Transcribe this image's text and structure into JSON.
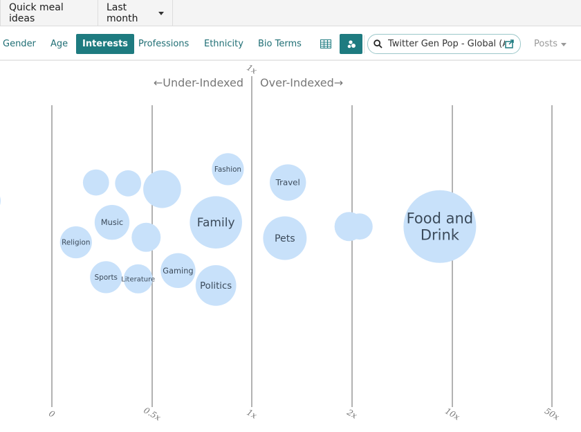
{
  "topbar": {
    "query_name": "Quick meal ideas",
    "date_range": "Last month"
  },
  "tabs": [
    {
      "label": "Gender",
      "active": false
    },
    {
      "label": "Age",
      "active": false
    },
    {
      "label": "Interests",
      "active": true
    },
    {
      "label": "Professions",
      "active": false
    },
    {
      "label": "Ethnicity",
      "active": false
    },
    {
      "label": "Bio Terms",
      "active": false
    }
  ],
  "view_toggle": {
    "table_icon": "table-grid-icon",
    "bubble_icon": "bubble-chart-icon",
    "active": "bubble"
  },
  "audience_search": {
    "value": "Twitter Gen Pop - Global (All)",
    "icon": "search-icon",
    "action_icon": "external-link-icon"
  },
  "metric_dropdown": {
    "label": "Posts"
  },
  "chart_data": {
    "type": "scatter",
    "subtype": "bubble",
    "title": "",
    "xlabel": "",
    "ylabel": "",
    "annotations": {
      "center_tick": "1x",
      "left": "←Under-Indexed",
      "right": "Over-Indexed→"
    },
    "x_scale": "index",
    "x_ticks": [
      "0",
      "0.5x",
      "1x",
      "2x",
      "10x",
      "50x"
    ],
    "grid": true,
    "legend": "none",
    "bubbles": [
      {
        "label": "",
        "index": 0.0,
        "size": 1.0,
        "y": 0.5,
        "partial": true
      },
      {
        "label": "",
        "index": 0.22,
        "size": 0.9,
        "y": 0.72
      },
      {
        "label": "",
        "index": 0.38,
        "size": 0.9,
        "y": 0.71
      },
      {
        "label": "",
        "index": 0.55,
        "size": 1.3,
        "y": 0.64
      },
      {
        "label": "Fashion",
        "index": 0.88,
        "size": 1.1,
        "y": 0.88
      },
      {
        "label": "Family",
        "index": 0.82,
        "size": 1.8,
        "y": 0.24
      },
      {
        "label": "Music",
        "index": 0.3,
        "size": 1.2,
        "y": 0.24
      },
      {
        "label": "Religion",
        "index": 0.12,
        "size": 1.1,
        "y": 0.0
      },
      {
        "label": "",
        "index": 0.47,
        "size": 1.0,
        "y": 0.06
      },
      {
        "label": "Gaming",
        "index": 0.63,
        "size": 1.2,
        "y": -0.34
      },
      {
        "label": "Sports",
        "index": 0.27,
        "size": 1.1,
        "y": -0.42
      },
      {
        "label": "Literature",
        "index": 0.43,
        "size": 1.0,
        "y": -0.44
      },
      {
        "label": "Politics",
        "index": 0.82,
        "size": 1.4,
        "y": -0.52
      },
      {
        "label": "Travel",
        "index": 1.36,
        "size": 1.25,
        "y": 0.72
      },
      {
        "label": "Pets",
        "index": 1.33,
        "size": 1.5,
        "y": 0.05
      },
      {
        "label": "",
        "index": 1.97,
        "size": 1.0,
        "y": 0.19
      },
      {
        "label": "",
        "index": 2.6,
        "size": 0.9,
        "y": 0.19
      },
      {
        "label": "Food and Drink",
        "index": 9.0,
        "size": 2.5,
        "y": 0.19
      }
    ]
  },
  "colors": {
    "accent": "#1e7b80",
    "bubble": "#c8e1fa",
    "gridline": "#999999",
    "bubble_text": "#3b4a5a"
  }
}
